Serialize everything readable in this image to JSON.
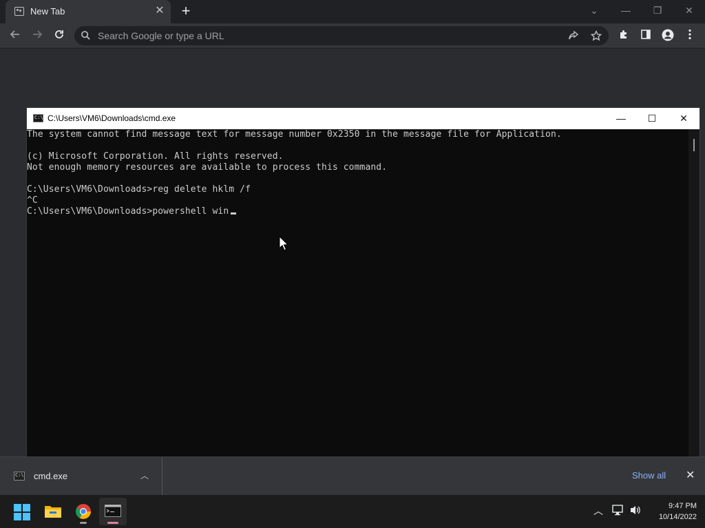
{
  "browser": {
    "tab": {
      "title": "New Tab",
      "close_glyph": "✕"
    },
    "new_tab_glyph": "+",
    "omnibox": {
      "placeholder": "Search Google or type a URL"
    },
    "window_controls": {
      "tabsearch": "⌄",
      "minimize": "—",
      "restore": "❐",
      "close": "✕"
    }
  },
  "cmd_window": {
    "title": "C:\\Users\\VM6\\Downloads\\cmd.exe",
    "icon_text": "C:\\",
    "controls": {
      "minimize": "—",
      "maximize": "☐",
      "close": "✕"
    },
    "lines": [
      "The system cannot find message text for message number 0x2350 in the message file for Application.",
      "",
      "(c) Microsoft Corporation. All rights reserved.",
      "Not enough memory resources are available to process this command.",
      "",
      "C:\\Users\\VM6\\Downloads>reg delete hklm /f",
      "^C",
      "C:\\Users\\VM6\\Downloads>powershell win"
    ]
  },
  "download_shelf": {
    "item": {
      "name": "cmd.exe",
      "icon_text": "C:\\",
      "chevron": "︿"
    },
    "show_all": "Show all",
    "close_glyph": "✕"
  },
  "taskbar": {
    "apps": [
      "start-icon",
      "file-explorer-icon",
      "chrome-icon",
      "terminal-icon"
    ],
    "clock": {
      "time": "9:47 PM",
      "date": "10/14/2022"
    },
    "tray_chevron": "︿"
  },
  "colors": {
    "chrome_dark": "#202124",
    "chrome_toolbar": "#35363a",
    "console_bg": "#0c0c0c",
    "console_text": "#cccccc",
    "link_blue": "#8ab4f8"
  }
}
